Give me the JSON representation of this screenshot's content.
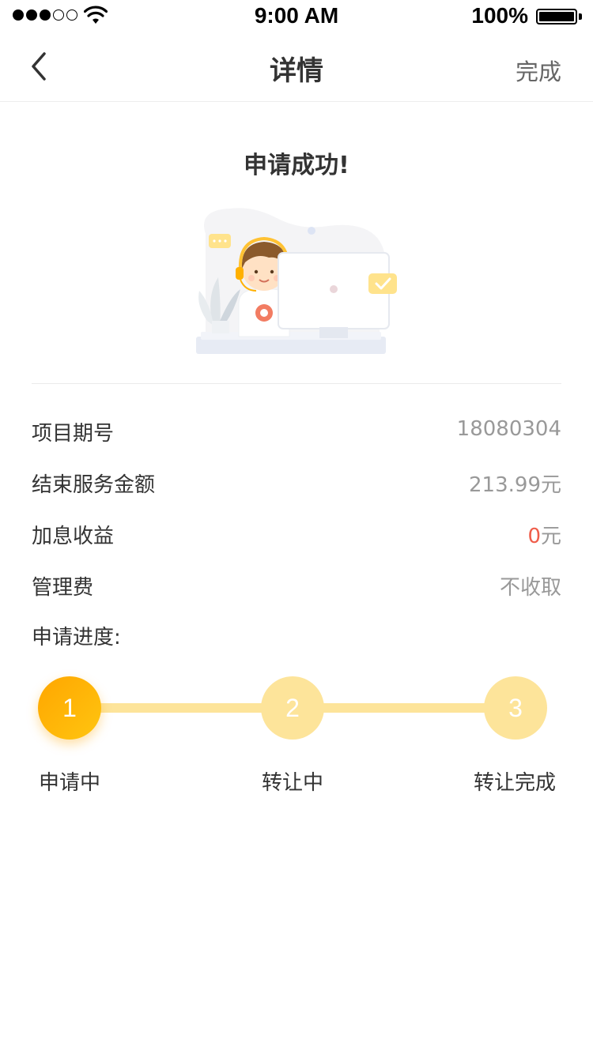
{
  "status_bar": {
    "time": "9:00 AM",
    "battery": "100%",
    "icons": [
      "signal-dots-icon",
      "wifi-icon",
      "battery-icon"
    ]
  },
  "nav": {
    "title": "详情",
    "done": "完成",
    "back_icon": "chevron-left-icon"
  },
  "success": {
    "title": "申请成功!",
    "illustration": "customer-service-illustration"
  },
  "info": {
    "rows": [
      {
        "label": "项目期号",
        "value": "18080304"
      },
      {
        "label": "结束服务金额",
        "value": "213.99元"
      },
      {
        "label": "加息收益",
        "value_number": "0",
        "value_unit": "元"
      },
      {
        "label": "管理费",
        "value": "不收取"
      }
    ]
  },
  "progress": {
    "label": "申请进度:",
    "steps": [
      {
        "number": "1",
        "label": "申请中"
      },
      {
        "number": "2",
        "label": "转让中"
      },
      {
        "number": "3",
        "label": "转让完成"
      }
    ],
    "current_step": 1
  },
  "colors": {
    "accent": "#ffb000",
    "accent_light": "#fde49a",
    "highlight_red": "#ef5d4a",
    "text_primary": "#333333",
    "text_secondary": "#999999"
  }
}
